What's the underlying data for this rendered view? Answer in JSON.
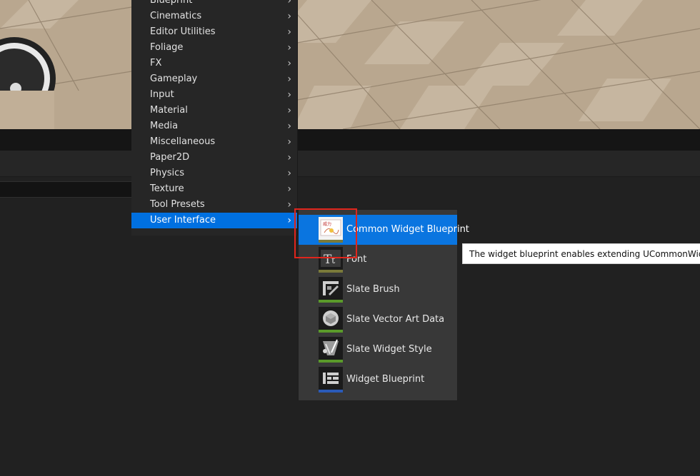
{
  "menu": {
    "items": [
      {
        "label": "Blueprint"
      },
      {
        "label": "Cinematics"
      },
      {
        "label": "Editor Utilities"
      },
      {
        "label": "Foliage"
      },
      {
        "label": "FX"
      },
      {
        "label": "Gameplay"
      },
      {
        "label": "Input"
      },
      {
        "label": "Material"
      },
      {
        "label": "Media"
      },
      {
        "label": "Miscellaneous"
      },
      {
        "label": "Paper2D"
      },
      {
        "label": "Physics"
      },
      {
        "label": "Texture"
      },
      {
        "label": "Tool Presets"
      },
      {
        "label": "User Interface"
      }
    ],
    "active_item": "User Interface",
    "chevron": "›"
  },
  "submenu": {
    "items": [
      {
        "label": "Common Widget Blueprint",
        "icon": "common-widget-blueprint-icon",
        "color": "#7a7a3a"
      },
      {
        "label": "Font",
        "icon": "font-icon",
        "color": "#7a7a3a"
      },
      {
        "label": "Slate Brush",
        "icon": "slate-brush-icon",
        "color": "#5a9a2a"
      },
      {
        "label": "Slate Vector Art Data",
        "icon": "slate-vector-art-icon",
        "color": "#5a9a2a"
      },
      {
        "label": "Slate Widget Style",
        "icon": "slate-widget-style-icon",
        "color": "#5a9a2a"
      },
      {
        "label": "Widget Blueprint",
        "icon": "widget-blueprint-icon",
        "color": "#2a5ab8"
      }
    ],
    "active_item": "Common Widget Blueprint"
  },
  "tooltip": {
    "text": "The widget blueprint enables extending UCommonWidgetBlu"
  },
  "colors": {
    "accent": "#0070e0",
    "highlight_box": "#e0251c",
    "menu_bg": "#262626",
    "submenu_bg": "#383838"
  }
}
